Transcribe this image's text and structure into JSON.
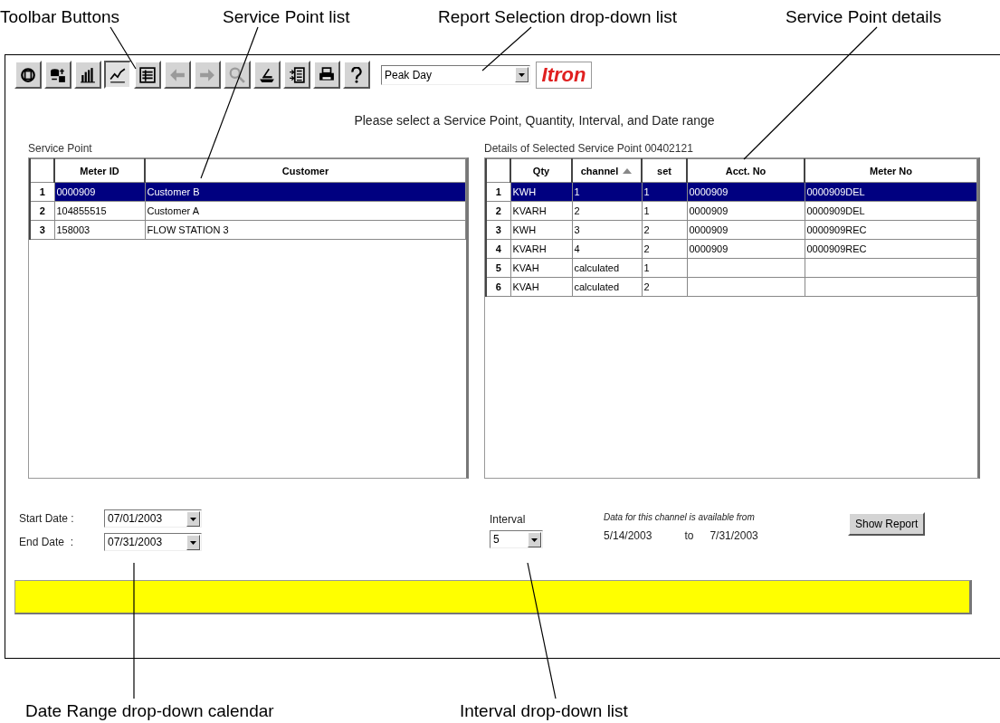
{
  "callouts": [
    {
      "text": "Toolbar Buttons"
    },
    {
      "text": "Service Point list"
    },
    {
      "text": "Report Selection drop-down list"
    },
    {
      "text": "Service Point details"
    },
    {
      "text": "Date Range drop-down calendar"
    },
    {
      "text": "Interval drop-down list"
    }
  ],
  "toolbar": {
    "buttons": [
      {
        "selected": false,
        "disabled": false
      },
      {
        "selected": false,
        "disabled": false
      },
      {
        "selected": false,
        "disabled": false
      },
      {
        "selected": true,
        "disabled": false
      },
      {
        "selected": false,
        "disabled": false
      },
      {
        "selected": false,
        "disabled": true
      },
      {
        "selected": false,
        "disabled": true
      },
      {
        "selected": false,
        "disabled": true
      },
      {
        "selected": false,
        "disabled": false
      },
      {
        "selected": false,
        "disabled": false
      },
      {
        "selected": false,
        "disabled": false
      },
      {
        "selected": false,
        "disabled": false
      }
    ],
    "report_select": {
      "value": "Peak Day"
    },
    "logo": "Itron"
  },
  "prompt": "Please select a Service Point, Quantity, Interval, and Date range",
  "service_point": {
    "title": "Service Point",
    "columns": [
      {
        "label": "Meter ID",
        "sorted": false
      },
      {
        "label": "Customer",
        "sorted": false
      }
    ],
    "rows": [
      {
        "index": "1",
        "selected": true,
        "cells": [
          "0000909",
          "Customer B"
        ]
      },
      {
        "index": "2",
        "selected": false,
        "cells": [
          "104855515",
          "Customer A"
        ]
      },
      {
        "index": "3",
        "selected": false,
        "cells": [
          "158003",
          "FLOW STATION 3"
        ]
      }
    ]
  },
  "details": {
    "title": "Details of Selected Service Point 00402121",
    "columns": [
      {
        "label": "Qty",
        "sorted": false
      },
      {
        "label": "channel",
        "sorted": true
      },
      {
        "label": "set",
        "sorted": false
      },
      {
        "label": "Acct. No",
        "sorted": false
      },
      {
        "label": "Meter No",
        "sorted": false
      }
    ],
    "rows": [
      {
        "index": "1",
        "selected": true,
        "cells": [
          "KWH",
          "1",
          "1",
          "0000909",
          "0000909DEL"
        ]
      },
      {
        "index": "2",
        "selected": false,
        "cells": [
          "KVARH",
          "2",
          "1",
          "0000909",
          "0000909DEL"
        ]
      },
      {
        "index": "3",
        "selected": false,
        "cells": [
          "KWH",
          "3",
          "2",
          "0000909",
          "0000909REC"
        ]
      },
      {
        "index": "4",
        "selected": false,
        "cells": [
          "KVARH",
          "4",
          "2",
          "0000909",
          "0000909REC"
        ]
      },
      {
        "index": "5",
        "selected": false,
        "cells": [
          "KVAH",
          "calculated",
          "1",
          null,
          null
        ]
      },
      {
        "index": "6",
        "selected": false,
        "cells": [
          "KVAH",
          "calculated",
          "2",
          null,
          null
        ]
      }
    ]
  },
  "dates": [
    {
      "label": "Start Date :",
      "value": "07/01/2003"
    },
    {
      "label": "End Date  :",
      "value": "07/31/2003"
    }
  ],
  "interval": {
    "label": "Interval",
    "value": "5"
  },
  "availability": {
    "note": "Data for this channel is available from",
    "from": "5/14/2003",
    "to_label": "to",
    "to": "7/31/2003"
  },
  "show_report": "Show Report"
}
